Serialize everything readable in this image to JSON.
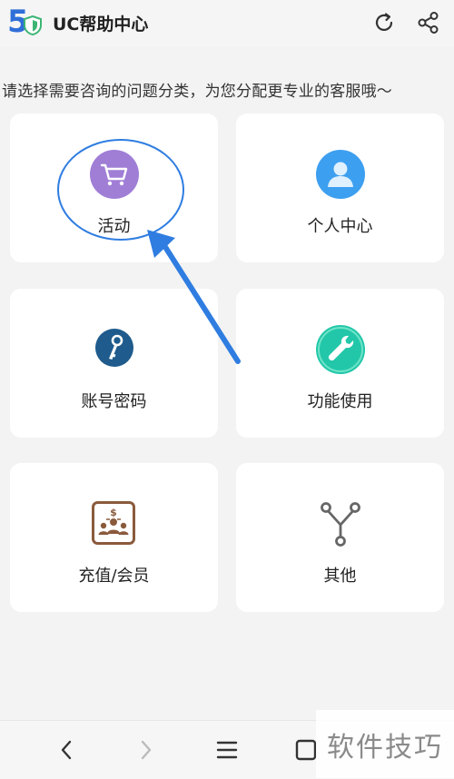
{
  "header": {
    "logo_text": "5",
    "title": "UC帮助中心",
    "icons": [
      "refresh-icon",
      "share-icon"
    ]
  },
  "prompt": "请选择需要咨询的问题分类，为您分配更专业的客服哦～",
  "categories": [
    {
      "label": "活动",
      "icon": "shopping-cart-icon",
      "color": "#a07ed6"
    },
    {
      "label": "个人中心",
      "icon": "user-profile-icon",
      "color": "#3d9ff0"
    },
    {
      "label": "账号密码",
      "icon": "key-icon",
      "color": "#1f5b8c"
    },
    {
      "label": "功能使用",
      "icon": "wrench-icon",
      "color": "#22c7a9"
    },
    {
      "label": "充值/会员",
      "icon": "recharge-members-icon",
      "color": "#8a5a3c"
    },
    {
      "label": "其他",
      "icon": "branch-icon",
      "color": "#666666"
    }
  ],
  "annotation": {
    "color": "#2f7de1"
  },
  "bottom_nav": {
    "icons": [
      "back-icon",
      "forward-icon",
      "menu-icon",
      "tabs-icon"
    ]
  },
  "watermark": "软件技巧"
}
